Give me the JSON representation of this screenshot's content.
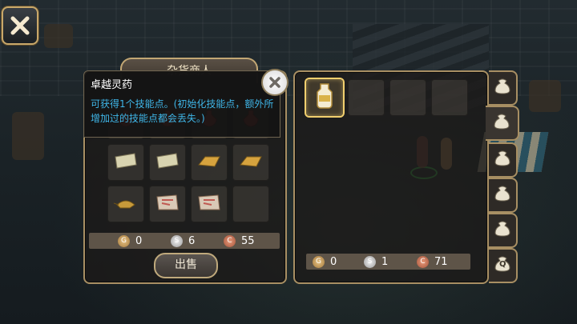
{
  "shop_tab": {
    "label": "杂货商人"
  },
  "tooltip": {
    "name": "卓越灵药",
    "description": "可获得1个技能点。(初始化技能点，额外所增加过的技能点都会丢失。)"
  },
  "sell_button": {
    "label": "出售"
  },
  "left_money": {
    "gold": "0",
    "silver": "6",
    "copper": "55"
  },
  "right_money": {
    "gold": "0",
    "silver": "1",
    "copper": "71"
  },
  "left_items": [
    {
      "icon": "red-potion-icon"
    },
    {
      "icon": "red-potion-icon"
    },
    {
      "icon": "red-potion-icon"
    },
    {
      "icon": "red-potion-icon"
    },
    {
      "icon": "scroll-icon"
    },
    {
      "icon": "scroll-icon"
    },
    {
      "icon": "gold-bar-icon"
    },
    {
      "icon": "gold-bar-icon"
    },
    {
      "icon": "magic-lamp-icon"
    },
    {
      "icon": "map-scroll-icon"
    },
    {
      "icon": "map-scroll-icon"
    },
    {
      "icon": "empty-slot"
    }
  ],
  "right_items": [
    {
      "icon": "elixir-jar-icon",
      "selected": true
    },
    {
      "icon": "empty-slot"
    },
    {
      "icon": "empty-slot"
    },
    {
      "icon": "empty-slot"
    }
  ],
  "bag_tabs": [
    {
      "icon": "bag-icon",
      "active": false
    },
    {
      "icon": "bag-icon",
      "active": true
    },
    {
      "icon": "bag-icon",
      "active": false
    },
    {
      "icon": "bag-icon",
      "active": false
    },
    {
      "icon": "bag-icon",
      "active": false
    },
    {
      "icon": "quest-bag-icon",
      "label": "Q",
      "active": false
    }
  ],
  "colors": {
    "panel_border": "#a88f63",
    "tooltip_text": "#3fb6e8",
    "selected_slot": "#f1cf6e"
  }
}
